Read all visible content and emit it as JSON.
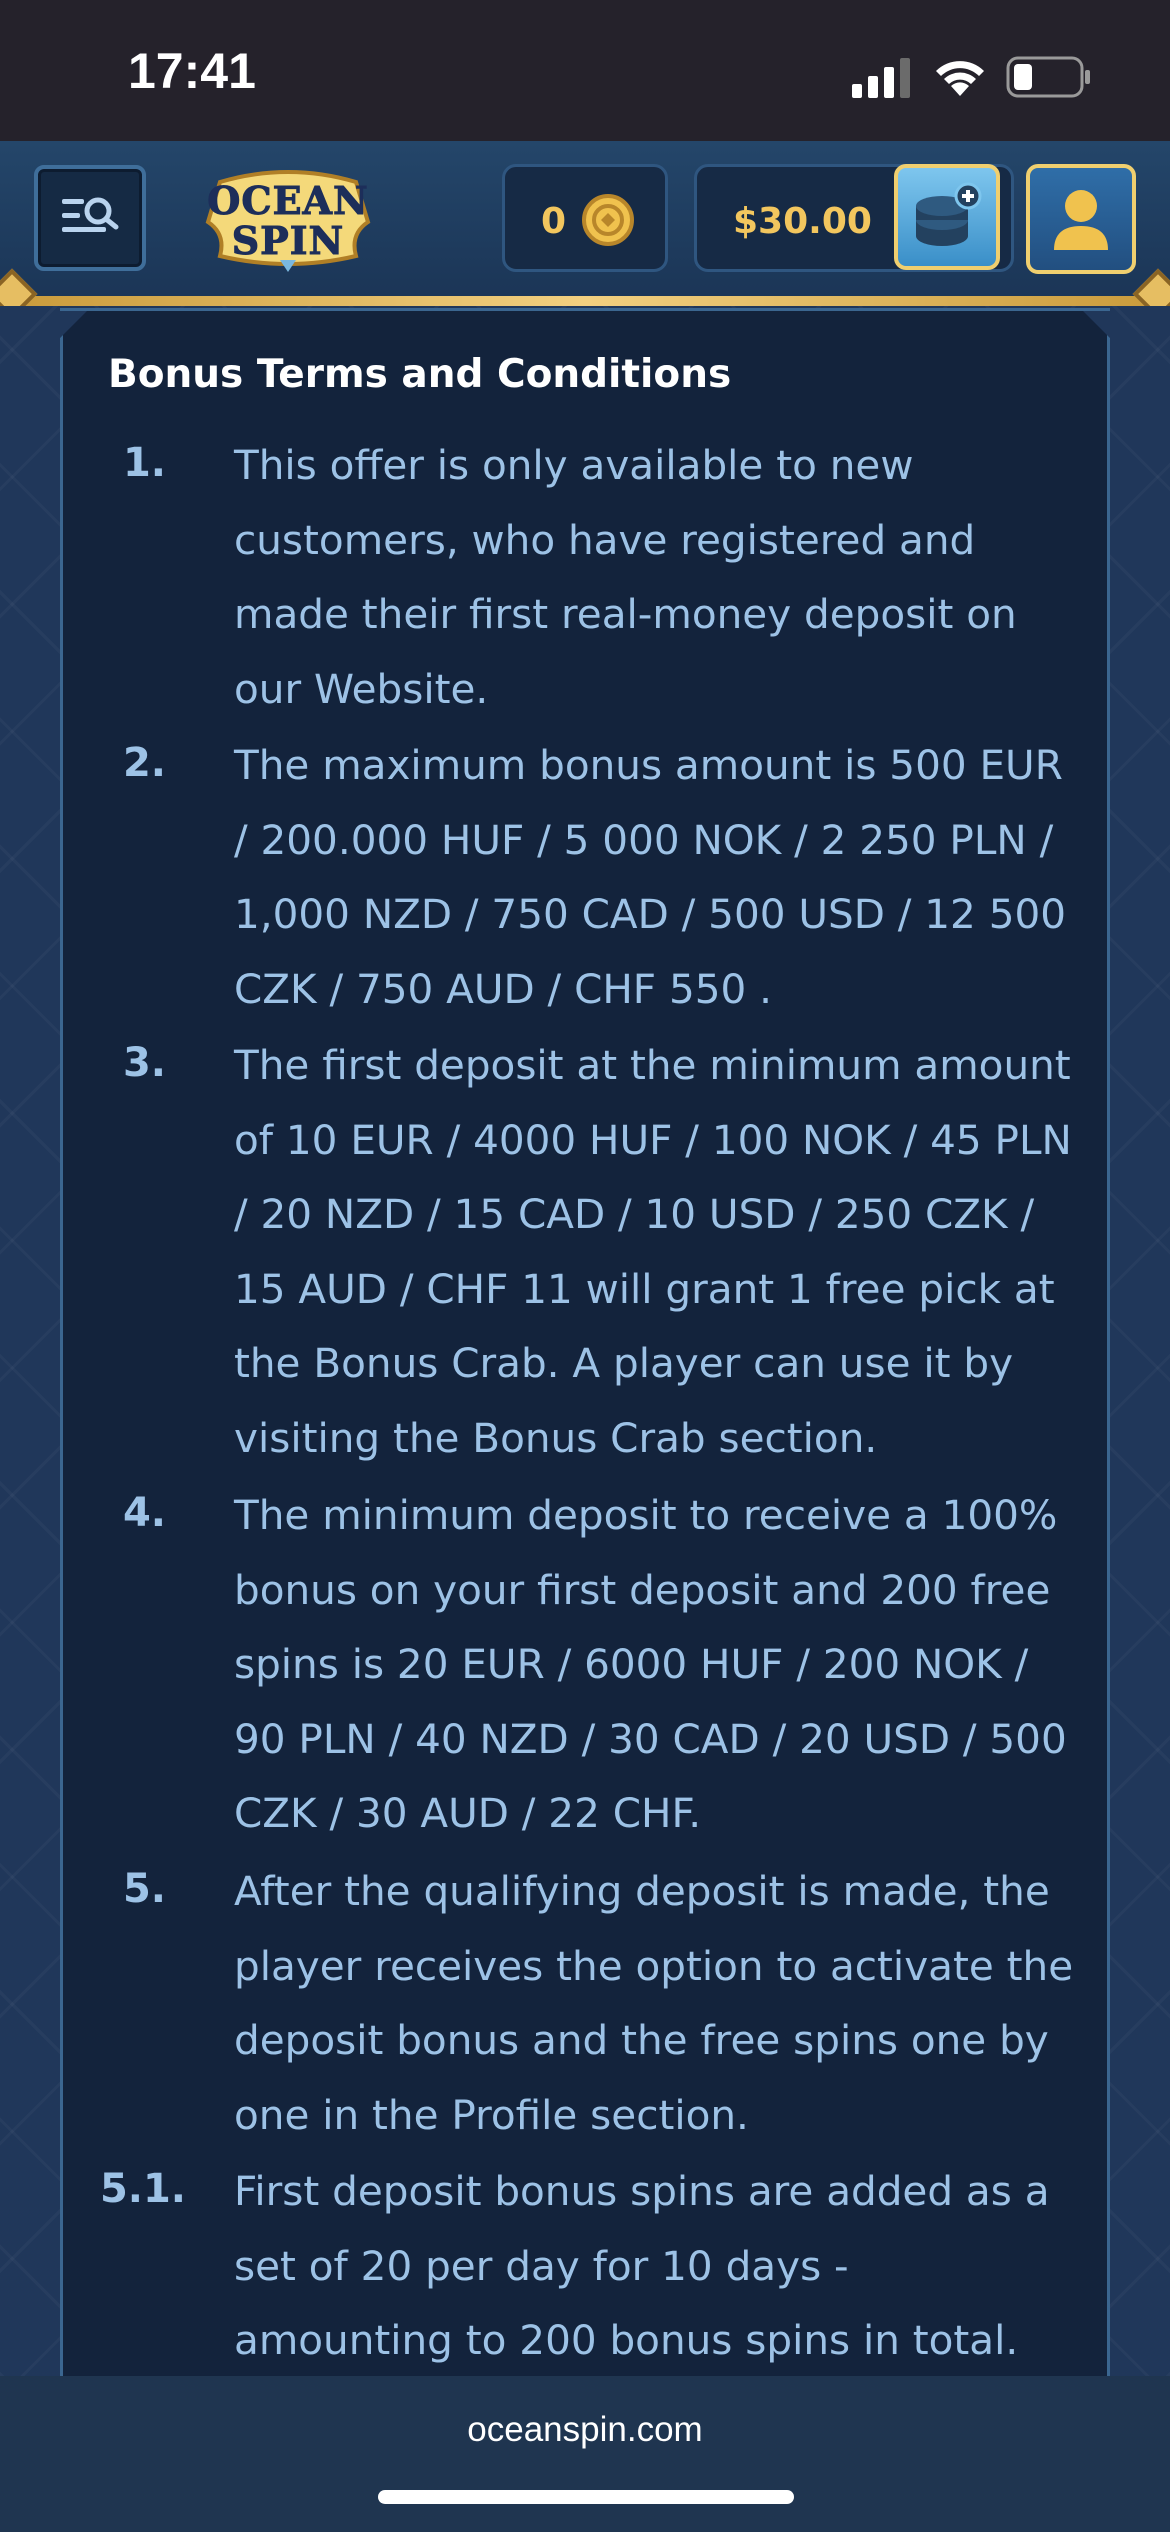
{
  "status_bar": {
    "time": "17:41"
  },
  "header": {
    "logo_line1": "OCEAN",
    "logo_line2": "SPIN",
    "coins": "0",
    "balance": "$30.00",
    "icons": {
      "menu": "menu-search-icon",
      "coin": "coin-icon",
      "deposit": "deposit-coins-icon",
      "profile": "user-icon"
    }
  },
  "content": {
    "title": "Bonus Terms and Conditions",
    "terms": [
      {
        "number": "1.",
        "text": "This offer is only available to new customers, who have registered and made their first real-money deposit on our Website."
      },
      {
        "number": "2.",
        "text": "The maximum bonus amount is 500 EUR / 200.000 HUF / 5 000 NOK / 2 250 PLN / 1,000 NZD / 750 CAD / 500 USD / 12 500 CZK / 750 AUD / CHF 550 ."
      },
      {
        "number": "3.",
        "text": "The first deposit at the minimum amount of 10 EUR / 4000 HUF / 100 NOK / 45 PLN / 20 NZD / 15 CAD / 10 USD / 250 CZK / 15 AUD / CHF 11 will grant 1 free pick at the Bonus Crab. A player can use it by visiting the Bonus Crab section."
      },
      {
        "number": "4.",
        "text": "The minimum deposit to receive a 100% bonus on your first deposit and 200 free spins is 20 EUR / 6000 HUF / 200 NOK / 90 PLN / 40 NZD / 30 CAD / 20 USD / 500 CZK / 30 AUD / 22 CHF."
      },
      {
        "number": "5.",
        "text": "After the qualifying deposit is made, the player receives the option to activate the deposit bonus and the free spins one by one in the Profile section."
      },
      {
        "number": "5.1.",
        "text": "First deposit bonus spins are added as a set of 20 per day for 10 days - amounting to 200 bonus spins in total."
      }
    ]
  },
  "browser": {
    "url": "oceanspin.com"
  },
  "colors": {
    "accent_gold": "#f2c65e",
    "panel": "#13233c",
    "text": "#9dc2e6"
  }
}
